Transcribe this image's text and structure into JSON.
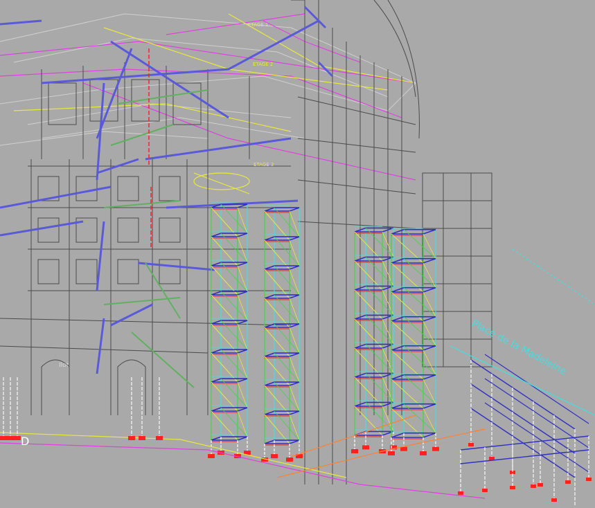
{
  "scene": {
    "background": "#a9a9a9",
    "colors": {
      "building": "#4a4a4a",
      "building_light": "#d8d8d8",
      "blue_structure": "#5a5ad8",
      "magenta": "#e040e0",
      "yellow": "#e8e840",
      "green": "#40d840",
      "cyan": "#40e0e0",
      "red": "#ff2020",
      "orange": "#ff8030",
      "scaffold_deck": "#3030c0"
    }
  },
  "annotations": {
    "axis_marker_d": "D",
    "street_label": "Place de la Madeleine",
    "roof_label_a": "ETAGE 1",
    "roof_label_b": "ETAGE 2",
    "roof_label_c": "ETAGE 3",
    "facade_label": "Ilot"
  }
}
